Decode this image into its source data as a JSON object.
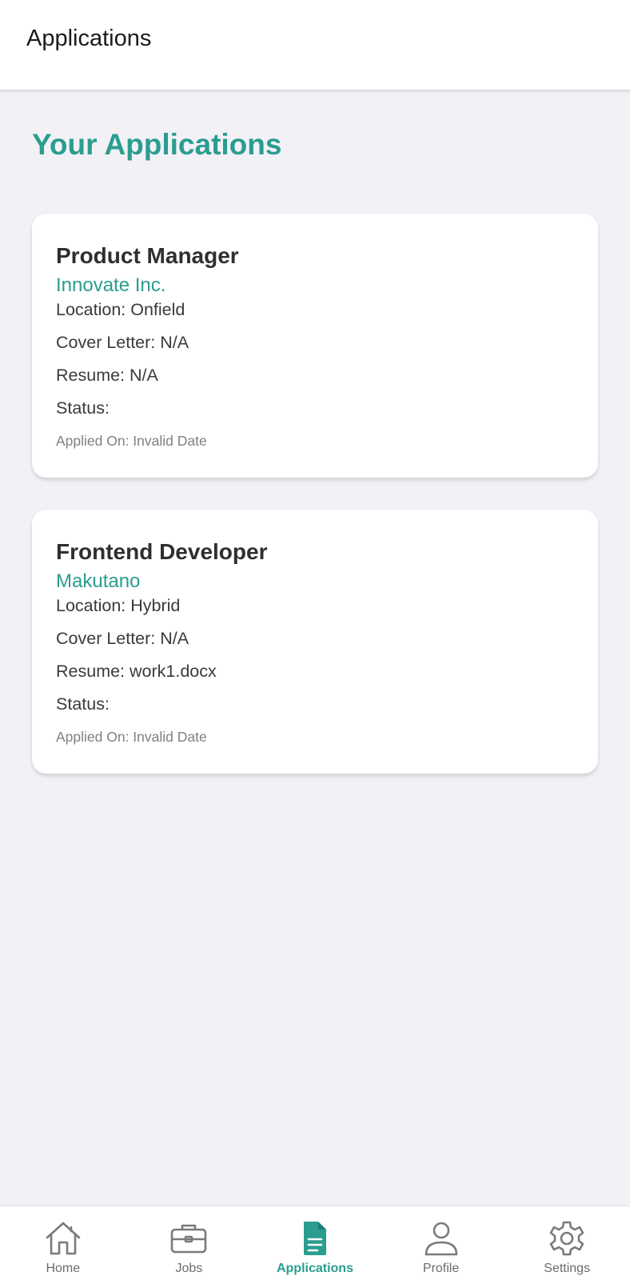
{
  "header": {
    "title": "Applications"
  },
  "main": {
    "heading": "Your Applications",
    "applications": [
      {
        "title": "Product Manager",
        "company": "Innovate Inc.",
        "location": "Location: Onfield",
        "cover_letter": "Cover Letter: N/A",
        "resume": "Resume: N/A",
        "status": "Status:",
        "applied_on": "Applied On: Invalid Date"
      },
      {
        "title": "Frontend Developer",
        "company": "Makutano",
        "location": "Location: Hybrid",
        "cover_letter": "Cover Letter: N/A",
        "resume": "Resume: work1.docx",
        "status": "Status:",
        "applied_on": "Applied On: Invalid Date"
      }
    ]
  },
  "bottom_nav": {
    "items": [
      {
        "label": "Home",
        "icon": "home-icon",
        "active": false
      },
      {
        "label": "Jobs",
        "icon": "briefcase-icon",
        "active": false
      },
      {
        "label": "Applications",
        "icon": "document-icon",
        "active": true
      },
      {
        "label": "Profile",
        "icon": "person-icon",
        "active": false
      },
      {
        "label": "Settings",
        "icon": "gear-icon",
        "active": false
      }
    ]
  },
  "colors": {
    "accent": "#2a9d8f",
    "background": "#f1f1f6",
    "card": "#ffffff",
    "inactive_icon": "#7a7a7a"
  }
}
